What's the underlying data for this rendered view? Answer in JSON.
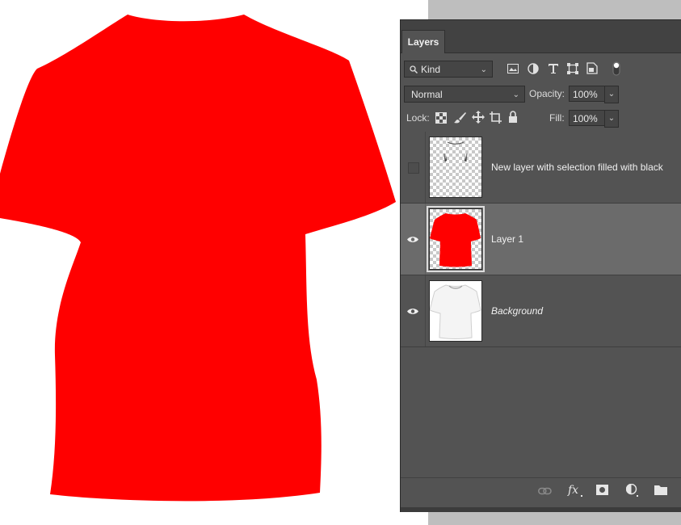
{
  "panel": {
    "tab_label": "Layers",
    "filter": {
      "selected": "Kind"
    },
    "blend_mode": "Normal",
    "opacity_label": "Opacity:",
    "opacity_value": "100%",
    "lock_label": "Lock:",
    "fill_label": "Fill:",
    "fill_value": "100%"
  },
  "layers": [
    {
      "name": "New layer with selection filled with black",
      "visible": false,
      "selected": false,
      "italic": false
    },
    {
      "name": "Layer 1",
      "visible": true,
      "selected": true,
      "italic": false
    },
    {
      "name": "Background",
      "visible": true,
      "selected": false,
      "italic": true
    }
  ],
  "colors": {
    "shirt": "#ff0000",
    "panel_bg": "#535353",
    "selected_row": "#6b6b6b"
  }
}
